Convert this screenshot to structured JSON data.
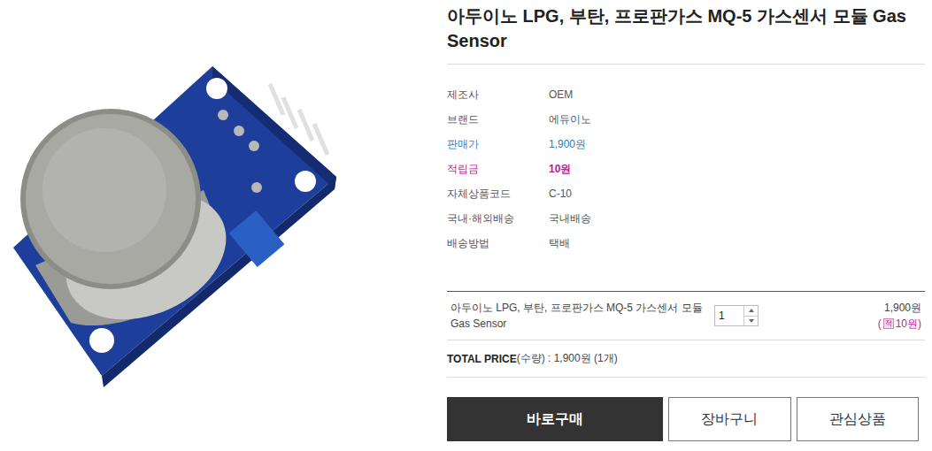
{
  "product": {
    "title": "아두이노 LPG, 부탄, 프로판가스 MQ-5 가스센서 모듈 Gas Sensor"
  },
  "info": [
    {
      "label": "제조사",
      "value": "OEM",
      "kind": "plain",
      "color": "#555555"
    },
    {
      "label": "브랜드",
      "value": "에듀이노",
      "kind": "plain",
      "color": "#555555"
    },
    {
      "label": "판매가",
      "value": "1,900원",
      "kind": "price",
      "color": "#2f7bbf"
    },
    {
      "label": "적립금",
      "value": "10원",
      "kind": "points",
      "color": "#c0179a"
    },
    {
      "label": "자체상품코드",
      "value": "C-10",
      "kind": "plain",
      "color": "#555555"
    },
    {
      "label": "국내·해외배송",
      "value": "국내배송",
      "kind": "plain",
      "color": "#555555"
    },
    {
      "label": "배송방법",
      "value": "택배",
      "kind": "plain",
      "color": "#555555"
    }
  ],
  "order": {
    "name": "아두이노 LPG, 부탄, 프로판가스 MQ-5 가스센서 모듈 Gas Sensor",
    "quantity": "1",
    "price": "1,900원",
    "points_open": "(",
    "points_icon": "적",
    "points": "10원)"
  },
  "total": {
    "label": "TOTAL PRICE",
    "detail": "(수량) : 1,900원 (1개)"
  },
  "buttons": [
    {
      "label": "바로구매",
      "kind": "primary"
    },
    {
      "label": "장바구니",
      "kind": "outline"
    },
    {
      "label": "관심상품",
      "kind": "outline"
    }
  ]
}
